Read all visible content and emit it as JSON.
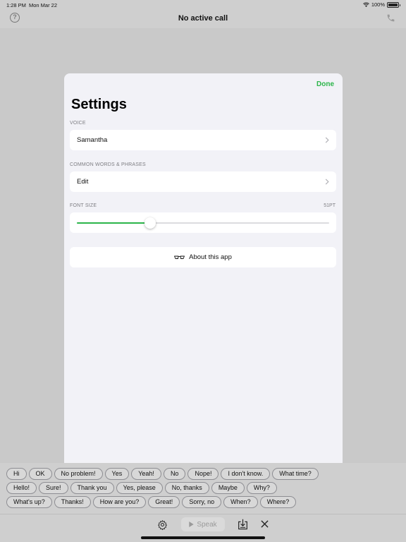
{
  "status_bar": {
    "time": "1:28 PM",
    "date": "Mon Mar 22",
    "battery": "100%",
    "icons": [
      "wifi-icon",
      "battery-icon"
    ]
  },
  "nav_bar": {
    "title": "No active call",
    "help_glyph": "?",
    "icons": [
      "help-icon",
      "phone-icon"
    ]
  },
  "settings": {
    "done_label": "Done",
    "title": "Settings",
    "voice": {
      "header": "VOICE",
      "value": "Samantha"
    },
    "common_words": {
      "header": "COMMON WORDS & PHRASES",
      "value": "Edit"
    },
    "font_size": {
      "header": "FONT SIZE",
      "value_label": "51PT",
      "slider_fraction": 0.29
    },
    "about_label": "About this app"
  },
  "phrases": {
    "row1": [
      "Hi",
      "OK",
      "No problem!",
      "Yes",
      "Yeah!",
      "No",
      "Nope!",
      "I don't know.",
      "What time?"
    ],
    "row2": [
      "Hello!",
      "Sure!",
      "Thank you",
      "Yes, please",
      "No, thanks",
      "Maybe",
      "Why?"
    ],
    "row3": [
      "What's up?",
      "Thanks!",
      "How are you?",
      "Great!",
      "Sorry, no",
      "When?",
      "Where?"
    ]
  },
  "toolbar": {
    "speak_label": "Speak",
    "icons": [
      "gear-icon",
      "play-icon",
      "save-icon",
      "close-icon"
    ]
  },
  "colors": {
    "accent": "#2cb54a",
    "background": "#c9c9c9",
    "modal_background": "#f2f2f7"
  }
}
